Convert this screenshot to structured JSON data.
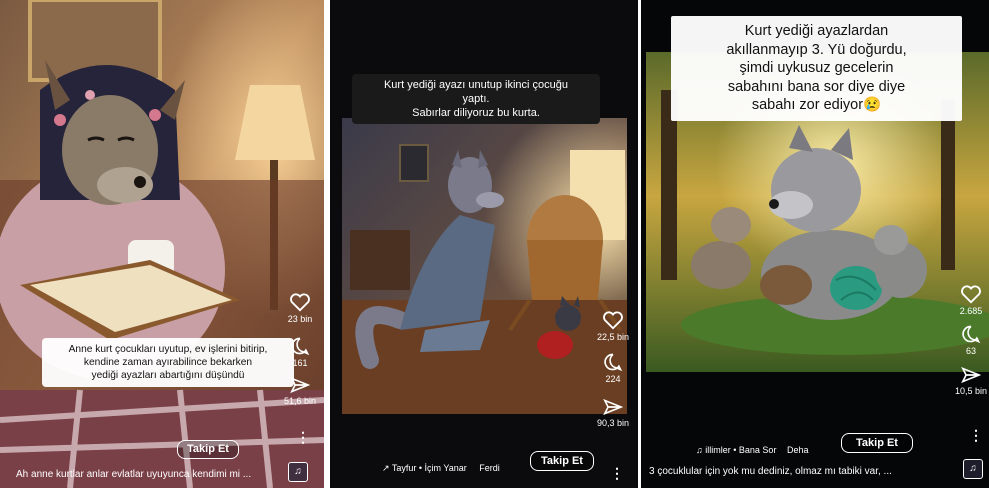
{
  "panels": [
    {
      "caption": "Anne kurt çocukları uyutup, ev işlerini bitirip,\nkendine zaman ayırabilince bekarken\nyediği ayazları abartığını düşündü",
      "likes": "23 bin",
      "comments": "161",
      "shares": "51,6 bin",
      "follow": "Takip Et",
      "bottom_caption": "Ah anne kurtlar anlar evlatlar uyuyunca kendimi mi ..."
    },
    {
      "caption": "Kurt yediği ayazı unutup ikinci çocuğu\nyaptı.\nSabırlar diliyoruz bu kurta.",
      "likes": "22,5 bin",
      "comments": "224",
      "shares": "90,3 bin",
      "follow": "Takip Et",
      "audio_left": "Tayfur • İçim Yanar",
      "audio_right": "Ferdi"
    },
    {
      "caption": "Kurt yediği ayazlardan\nakıllanmayıp 3. Yü doğurdu,\nşimdi uykusuz gecelerin\nsabahını bana sor diye diye\nsabahı zor ediyor😢",
      "likes": "2.685",
      "comments": "63",
      "shares": "10,5 bin",
      "follow": "Takip Et",
      "audio_left": "illimler • Bana Sor",
      "audio_right": "Deha",
      "bottom_caption": "3 çocuklular için yok mu dediniz, olmaz mı tabiki var, ..."
    }
  ]
}
